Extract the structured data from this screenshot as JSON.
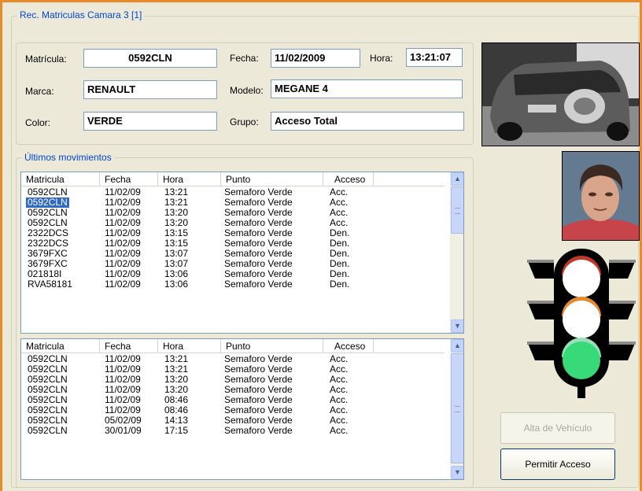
{
  "window": {
    "title": "Rec. Matriculas Camara 3 [1]"
  },
  "info": {
    "matricula_label": "Matrícula:",
    "matricula_value": "0592CLN",
    "fecha_label": "Fecha:",
    "fecha_value": "11/02/2009",
    "hora_label": "Hora:",
    "hora_value": "13:21:07",
    "marca_label": "Marca:",
    "marca_value": "RENAULT",
    "modelo_label": "Modelo:",
    "modelo_value": "MEGANE 4",
    "color_label": "Color:",
    "color_value": "VERDE",
    "grupo_label": "Grupo:",
    "grupo_value": "Acceso Total"
  },
  "movements": {
    "title": "Últimos movimientos",
    "columns": [
      "Matricula",
      "Fecha",
      "Hora",
      "Punto",
      "Acceso"
    ],
    "list1": [
      [
        "0592CLN",
        "11/02/09",
        "13:21",
        "Semaforo Verde",
        "Acc."
      ],
      [
        "0592CLN",
        "11/02/09",
        "13:21",
        "Semaforo Verde",
        "Acc."
      ],
      [
        "0592CLN",
        "11/02/09",
        "13:20",
        "Semaforo Verde",
        "Acc."
      ],
      [
        "0592CLN",
        "11/02/09",
        "13:20",
        "Semaforo Verde",
        "Acc."
      ],
      [
        "2322DCS",
        "11/02/09",
        "13:15",
        "Semaforo Verde",
        "Den."
      ],
      [
        "2322DCS",
        "11/02/09",
        "13:15",
        "Semaforo Verde",
        "Den."
      ],
      [
        "3679FXC",
        "11/02/09",
        "13:07",
        "Semaforo Verde",
        "Den."
      ],
      [
        "3679FXC",
        "11/02/09",
        "13:07",
        "Semaforo Verde",
        "Den."
      ],
      [
        "021818I",
        "11/02/09",
        "13:06",
        "Semaforo Verde",
        "Den."
      ],
      [
        "RVA58181",
        "11/02/09",
        "13:06",
        "Semaforo Verde",
        "Den."
      ]
    ],
    "list1_selected": 1,
    "list2": [
      [
        "0592CLN",
        "11/02/09",
        "13:21",
        "Semaforo Verde",
        "Acc."
      ],
      [
        "0592CLN",
        "11/02/09",
        "13:21",
        "Semaforo Verde",
        "Acc."
      ],
      [
        "0592CLN",
        "11/02/09",
        "13:20",
        "Semaforo Verde",
        "Acc."
      ],
      [
        "0592CLN",
        "11/02/09",
        "13:20",
        "Semaforo Verde",
        "Acc."
      ],
      [
        "0592CLN",
        "11/02/09",
        "08:46",
        "Semaforo Verde",
        "Acc."
      ],
      [
        "0592CLN",
        "11/02/09",
        "08:46",
        "Semaforo Verde",
        "Acc."
      ],
      [
        "0592CLN",
        "05/02/09",
        "14:13",
        "Semaforo Verde",
        "Acc."
      ],
      [
        "0592CLN",
        "30/01/09",
        "17:15",
        "Semaforo Verde",
        "Acc."
      ]
    ]
  },
  "buttons": {
    "alta_label": "Alta de Vehículo",
    "permitir_label": "Permitir Acceso"
  },
  "traffic_light": {
    "state": "green",
    "lamp_colors": {
      "off": "#ffffff",
      "green": "#38d978",
      "body": "#000000"
    }
  },
  "icons": {
    "scroll_up": "▲",
    "scroll_down": "▼"
  }
}
